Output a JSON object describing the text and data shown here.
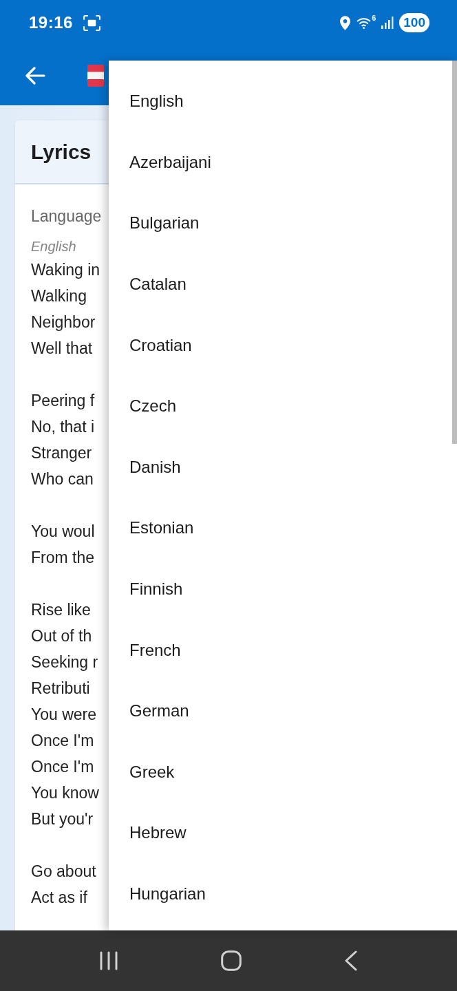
{
  "status_bar": {
    "time": "19:16",
    "wifi_badge": "6",
    "battery": "100"
  },
  "card": {
    "title": "Lyrics",
    "language_label": "Language",
    "language_value": "English",
    "stanzas": [
      [
        "Waking in",
        "Walking",
        "Neighbor",
        "Well that"
      ],
      [
        "Peering f",
        "No, that i",
        "Stranger",
        "Who can"
      ],
      [
        "You woul",
        "From the"
      ],
      [
        "Rise like",
        "Out of th",
        "Seeking r",
        "Retributi",
        "You were",
        "Once I'm",
        "Once I'm",
        "You know",
        "But you'r"
      ],
      [
        "Go about",
        "Act as if"
      ]
    ]
  },
  "language_menu": {
    "items": [
      "English",
      "Azerbaijani",
      "Bulgarian",
      "Catalan",
      "Croatian",
      "Czech",
      "Danish",
      "Estonian",
      "Finnish",
      "French",
      "German",
      "Greek",
      "Hebrew",
      "Hungarian"
    ]
  }
}
